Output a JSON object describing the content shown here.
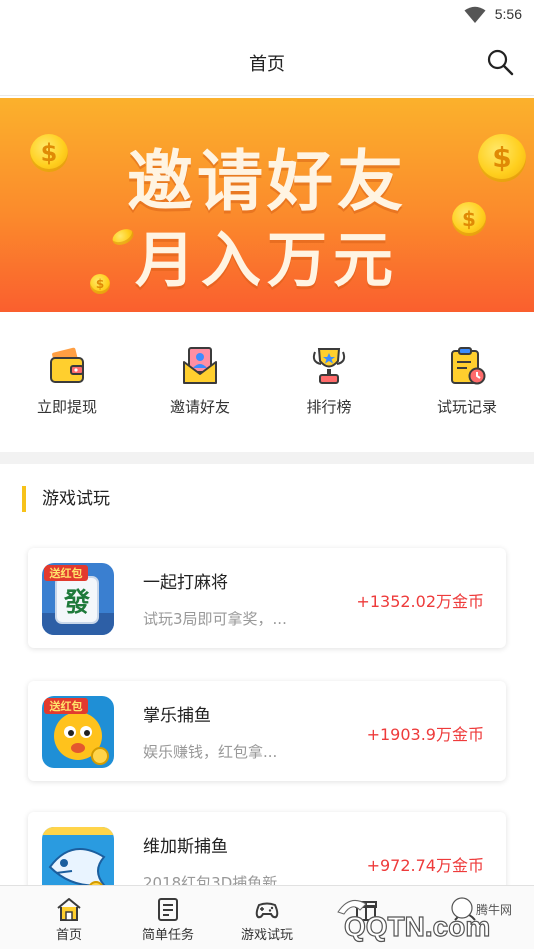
{
  "status_bar": {
    "time": "5:56",
    "wifi_icon": "wifi-icon"
  },
  "header": {
    "title": "首页",
    "search_icon": "search-icon"
  },
  "banner": {
    "line1": "邀请好友",
    "line2": "月入万元",
    "coin_symbol": "$"
  },
  "quick_actions": [
    {
      "label": "立即提现",
      "icon": "wallet-icon"
    },
    {
      "label": "邀请好友",
      "icon": "invite-envelope-icon"
    },
    {
      "label": "排行榜",
      "icon": "trophy-icon"
    },
    {
      "label": "试玩记录",
      "icon": "clipboard-clock-icon"
    }
  ],
  "section": {
    "title": "游戏试玩",
    "accent_color": "#f7c21a"
  },
  "games": [
    {
      "name": "一起打麻将",
      "desc": "试玩3局即可拿奖，...",
      "reward": "+1352.02万金币",
      "badge": "送红包",
      "tile": "發"
    },
    {
      "name": "掌乐捕鱼",
      "desc": "娱乐赚钱，红包拿...",
      "reward": "+1903.9万金币",
      "badge": "送红包"
    },
    {
      "name": "维加斯捕鱼",
      "desc": "2018红包3D捕鱼新",
      "reward": "+972.74万金币"
    }
  ],
  "bottom_nav": [
    {
      "label": "首页",
      "icon": "home-icon"
    },
    {
      "label": "简单任务",
      "icon": "task-list-icon"
    },
    {
      "label": "游戏试玩",
      "icon": "gamepad-icon"
    },
    {
      "label": "",
      "icon": "gift-icon"
    },
    {
      "label": "",
      "icon": "profile-icon"
    }
  ],
  "watermark": {
    "brand": "腾牛网",
    "text": "QQTN.com"
  },
  "colors": {
    "reward": "#ee3b3b",
    "banner_top": "#fbb12c",
    "banner_bottom": "#fa5f2e"
  }
}
